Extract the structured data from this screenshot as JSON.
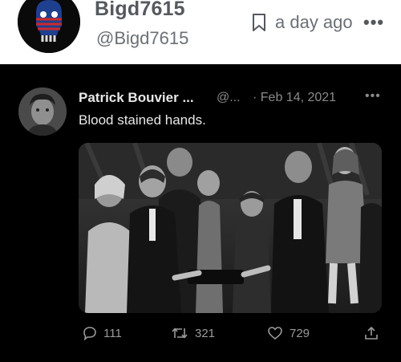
{
  "outer_post": {
    "display_name": "Bigd7615",
    "handle": "@Bigd7615",
    "time": "a day ago",
    "more": "•••"
  },
  "embedded_tweet": {
    "author_name": "Patrick Bouvier ...",
    "author_handle": "@...",
    "date": "· Feb 14, 2021",
    "more": "•••",
    "text": "Blood stained hands.",
    "actions": {
      "replies": "111",
      "retweets": "321",
      "likes": "729"
    }
  },
  "icons": {
    "bookmark": "bookmark-icon",
    "reply": "reply-icon",
    "retweet": "retweet-icon",
    "like": "heart-icon",
    "share": "share-icon"
  },
  "colors": {
    "embed_background": "#000000",
    "muted_text": "#8a8a8a",
    "header_text": "#55595e"
  }
}
